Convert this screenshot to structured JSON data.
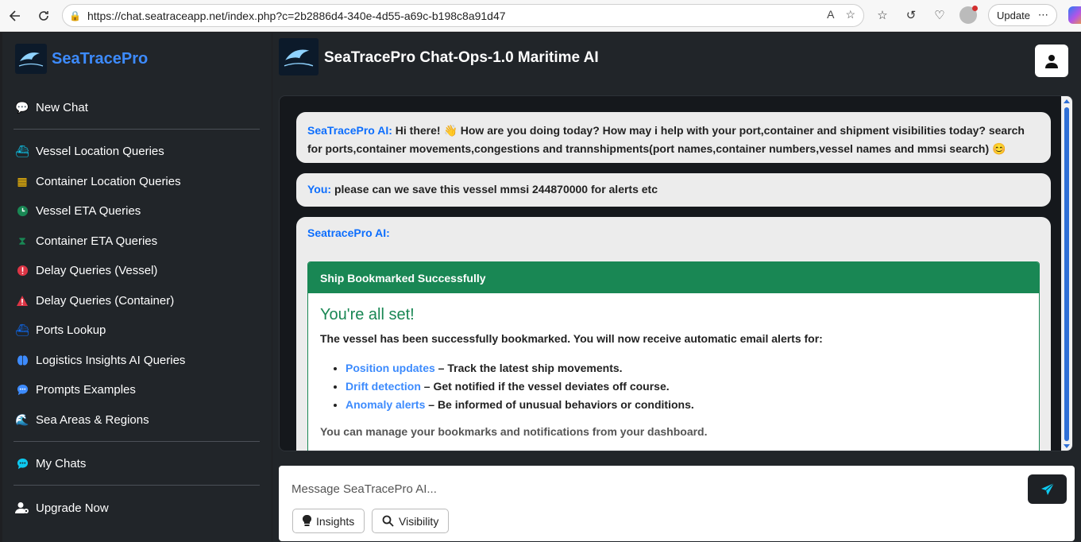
{
  "browser": {
    "url": "https://chat.seatraceapp.net/index.php?c=2b2886d4-340e-4d55-a69c-b198c8a91d47",
    "update_label": "Update"
  },
  "sidebar": {
    "brand": "SeaTracePro",
    "logo_text": "SeaTrace",
    "new_chat": "New Chat",
    "items": [
      {
        "label": "Vessel Location Queries",
        "icon": "ship-icon",
        "color": "#0dcaf0"
      },
      {
        "label": "Container Location Queries",
        "icon": "boxes-icon",
        "color": "#ffc107"
      },
      {
        "label": "Vessel ETA Queries",
        "icon": "clock-icon",
        "color": "#198754"
      },
      {
        "label": "Container ETA Queries",
        "icon": "hourglass-icon",
        "color": "#198754"
      },
      {
        "label": "Delay Queries (Vessel)",
        "icon": "alert-circle-icon",
        "color": "#dc3545"
      },
      {
        "label": "Delay Queries (Container)",
        "icon": "warning-icon",
        "color": "#dc3545"
      },
      {
        "label": "Ports Lookup",
        "icon": "ship-icon",
        "color": "#0d6efd"
      },
      {
        "label": "Logistics Insights AI Queries",
        "icon": "brain-icon",
        "color": "#3d8bfd"
      },
      {
        "label": "Prompts Examples",
        "icon": "chat-dots-icon",
        "color": "#3d8bfd"
      },
      {
        "label": "Sea Areas & Regions",
        "icon": "wave-icon",
        "color": "#0dcaf0"
      }
    ],
    "my_chats": "My Chats",
    "upgrade": "Upgrade Now"
  },
  "header": {
    "title": "SeaTracePro Chat-Ops-1.0 Maritime AI",
    "logo_text": "SeaTrace"
  },
  "messages": [
    {
      "who": "SeaTracePro AI:",
      "text": "Hi there! 👋 How are you doing today? How may i help with your port,container and shipment visibilities today? search for ports,container movements,congestions and trannshipments(port names,container numbers,vessel names and mmsi search) 😊"
    },
    {
      "who": "You:",
      "text": "please can we save this vessel mmsi 244870000 for alerts etc"
    },
    {
      "who": "SeatracePro AI:"
    }
  ],
  "card": {
    "header": "Ship Bookmarked Successfully",
    "title": "You're all set!",
    "intro": "The vessel has been successfully bookmarked. You will now receive automatic email alerts for:",
    "bullets": [
      {
        "label": "Position updates",
        "text": " – Track the latest ship movements."
      },
      {
        "label": "Drift detection",
        "text": " – Get notified if the vessel deviates off course."
      },
      {
        "label": "Anomaly alerts",
        "text": " – Be informed of unusual behaviors or conditions."
      }
    ],
    "footer": "You can manage your bookmarks and notifications from your dashboard."
  },
  "composer": {
    "placeholder": "Message SeaTracePro AI...",
    "chips": [
      "Insights",
      "Visibility"
    ]
  },
  "colors": {
    "accent": "#3d8bfd",
    "success": "#198754",
    "sidebar": "#212529"
  }
}
